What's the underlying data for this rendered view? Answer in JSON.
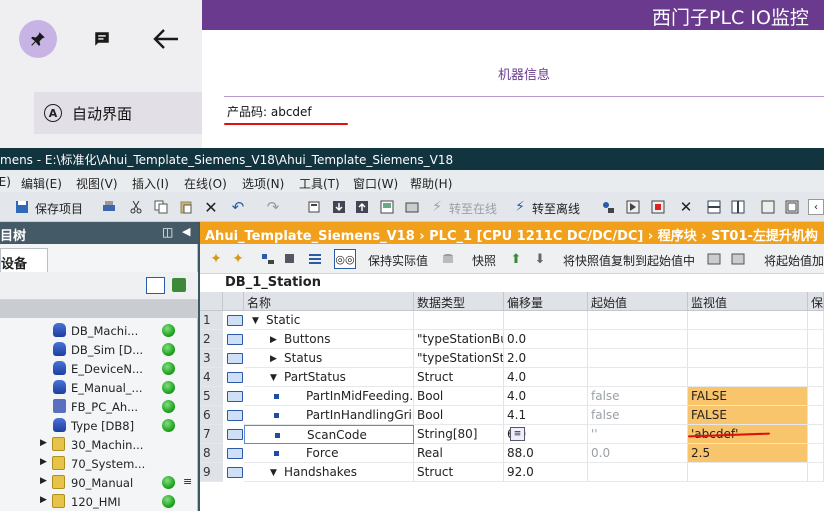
{
  "app": {
    "title": "西门子PLC IO监控",
    "nav_label": "自动界面",
    "nav_icon_letter": "A",
    "section_title": "机器信息",
    "product_code": "产品码: abcdef"
  },
  "tia": {
    "title": "mens  -  E:\\标准化\\Ahui_Template_Siemens_V18\\Ahui_Template_Siemens_V18",
    "menu": [
      "(E)",
      "编辑(E)",
      "视图(V)",
      "插入(I)",
      "在线(O)",
      "选项(N)",
      "工具(T)",
      "窗口(W)",
      "帮助(H)"
    ],
    "toolbar": {
      "save_project": "保存项目",
      "go_online": "转至在线",
      "go_offline": "转至离线"
    },
    "tree": {
      "header": "目树",
      "tab": "设备",
      "items": [
        {
          "label": "DB_Machi...",
          "kind": "db",
          "dot": true
        },
        {
          "label": "DB_Sim [D...",
          "kind": "db",
          "dot": true
        },
        {
          "label": "E_DeviceN...",
          "kind": "db",
          "dot": true
        },
        {
          "label": "E_Manual_...",
          "kind": "db",
          "dot": true
        },
        {
          "label": "FB_PC_Ah...",
          "kind": "fb",
          "dot": true
        },
        {
          "label": "Type [DB8]",
          "kind": "db",
          "dot": true
        },
        {
          "label": "30_Machin...",
          "kind": "folder",
          "dot": false
        },
        {
          "label": "70_System...",
          "kind": "folder",
          "dot": false
        },
        {
          "label": "90_Manual",
          "kind": "folder",
          "dot": true
        },
        {
          "label": "120_HMI",
          "kind": "folder",
          "dot": true
        }
      ]
    },
    "editor": {
      "breadcrumb": "Ahui_Template_Siemens_V18  ›  PLC_1 [CPU 1211C DC/DC/DC]  ›  程序块  ›  ST01-左提升机构",
      "toolbar": {
        "keep_actual": "保持实际值",
        "snapshot": "快照",
        "copy_snapshot": "将快照值复制到起始值中",
        "load_start": "将起始值加"
      },
      "block_title": "DB_1_Station",
      "columns": {
        "name": "名称",
        "type": "数据类型",
        "offset": "偏移量",
        "start": "起始值",
        "monitor": "监视值",
        "retain": "保"
      },
      "rows": [
        {
          "num": "1",
          "level": 0,
          "expand": "▼",
          "name": "Static",
          "type": "",
          "offset": "",
          "start": "",
          "monitor": ""
        },
        {
          "num": "2",
          "level": 1,
          "expand": "▶",
          "name": "Buttons",
          "type": "\"typeStationButtons\"",
          "offset": "0.0",
          "start": "",
          "monitor": ""
        },
        {
          "num": "3",
          "level": 1,
          "expand": "▶",
          "name": "Status",
          "type": "\"typeStationStatus\"",
          "offset": "2.0",
          "start": "",
          "monitor": ""
        },
        {
          "num": "4",
          "level": 1,
          "expand": "▼",
          "name": "PartStatus",
          "type": "Struct",
          "offset": "4.0",
          "start": "",
          "monitor": ""
        },
        {
          "num": "5",
          "level": 2,
          "expand": "",
          "name": "PartInMidFeeding...",
          "type": "Bool",
          "offset": "4.0",
          "start": "false",
          "monitor": "FALSE"
        },
        {
          "num": "6",
          "level": 2,
          "expand": "",
          "name": "PartInHandlingGri...",
          "type": "Bool",
          "offset": "4.1",
          "start": "false",
          "monitor": "FALSE"
        },
        {
          "num": "7",
          "level": 2,
          "expand": "",
          "name": "ScanCode",
          "type": "String[80]",
          "offset": "6.0",
          "start": "''",
          "monitor": "'abcdef'"
        },
        {
          "num": "8",
          "level": 2,
          "expand": "",
          "name": "Force",
          "type": "Real",
          "offset": "88.0",
          "start": "0.0",
          "monitor": "2.5"
        },
        {
          "num": "9",
          "level": 1,
          "expand": "▼",
          "name": "Handshakes",
          "type": "Struct",
          "offset": "92.0",
          "start": "",
          "monitor": ""
        }
      ]
    }
  },
  "colors": {
    "hmi_purple": "#6a3a8e",
    "tia_orange": "#f1a01b",
    "monitor_highlight": "#f9c56c",
    "annotation_red": "#e01010"
  }
}
